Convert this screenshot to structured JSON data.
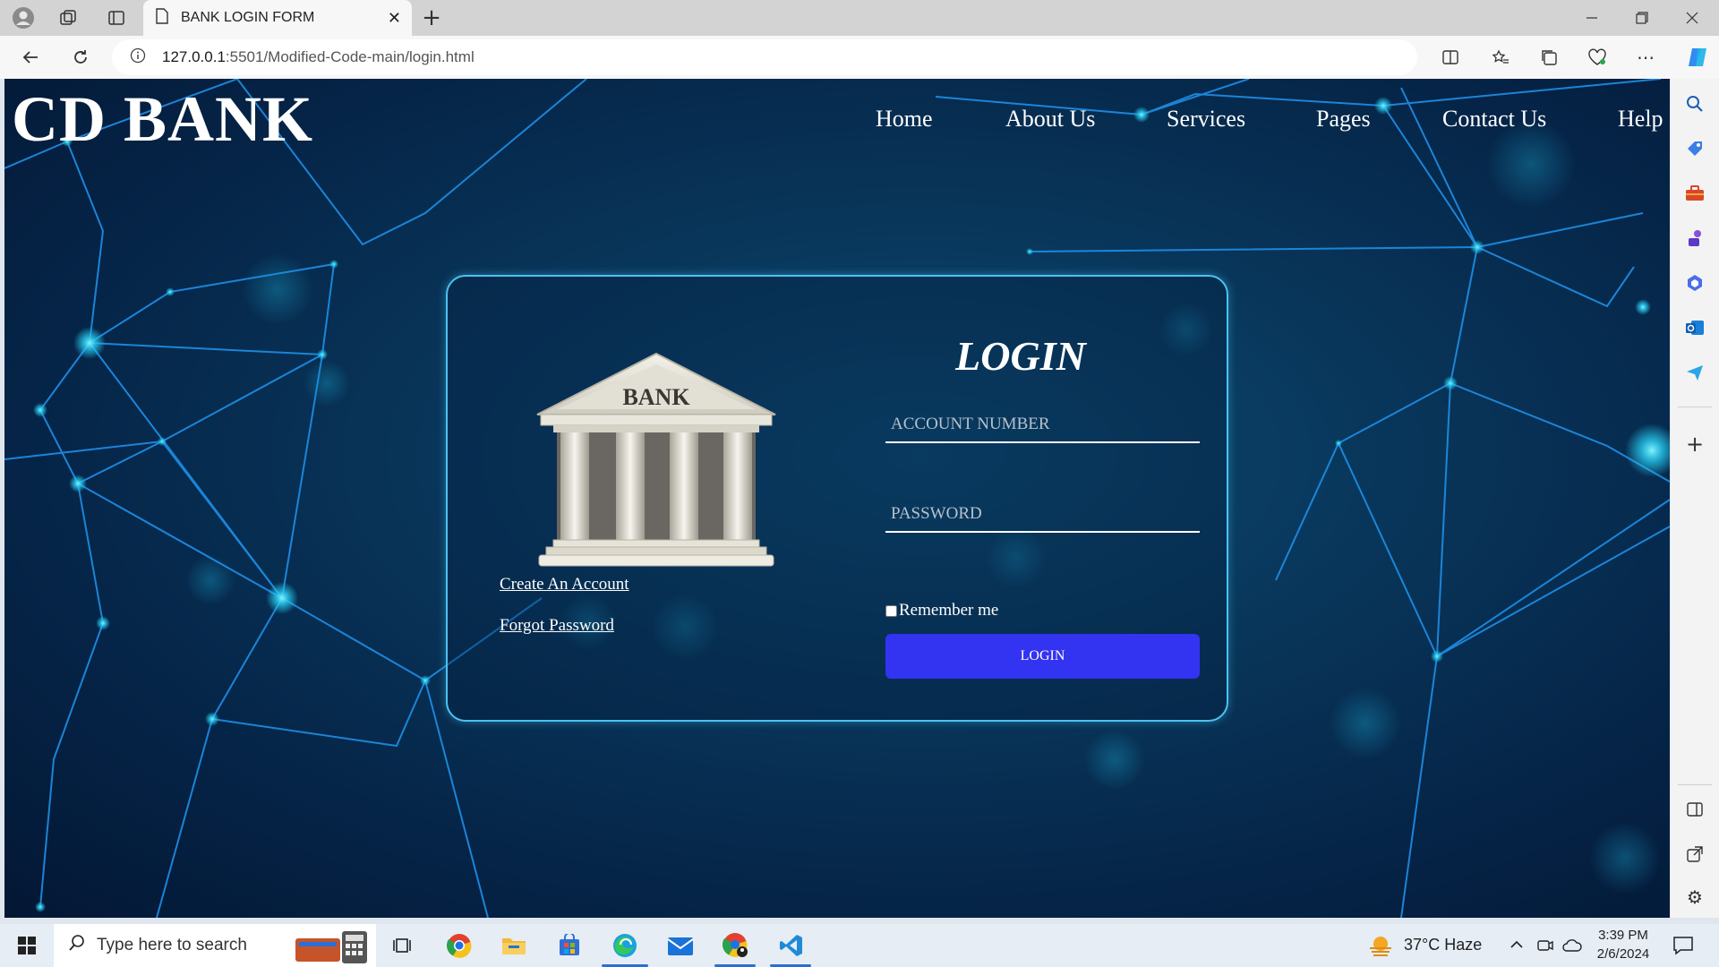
{
  "browser": {
    "tab_title": "BANK LOGIN FORM",
    "url_host": "127.0.0.1",
    "url_rest": ":5501/Modified-Code-main/login.html"
  },
  "site": {
    "brand": "CD BANK",
    "nav": [
      "Home",
      "About Us",
      "Services",
      "Pages",
      "Contact Us",
      "Help"
    ]
  },
  "login": {
    "title": "LOGIN",
    "illustration_label": "BANK",
    "account_placeholder": "ACCOUNT NUMBER",
    "password_placeholder": "PASSWORD",
    "remember_label": "Remember me",
    "button_label": "LOGIN",
    "create_account": "Create An Account",
    "forgot_password": "Forgot Password"
  },
  "taskbar": {
    "search_placeholder": "Type here to search",
    "weather": "37°C  Haze",
    "time": "3:39 PM",
    "date": "2/6/2024"
  },
  "colors": {
    "accent_button": "#3333f2",
    "card_border": "#4cc2ef",
    "background": "#052447"
  }
}
